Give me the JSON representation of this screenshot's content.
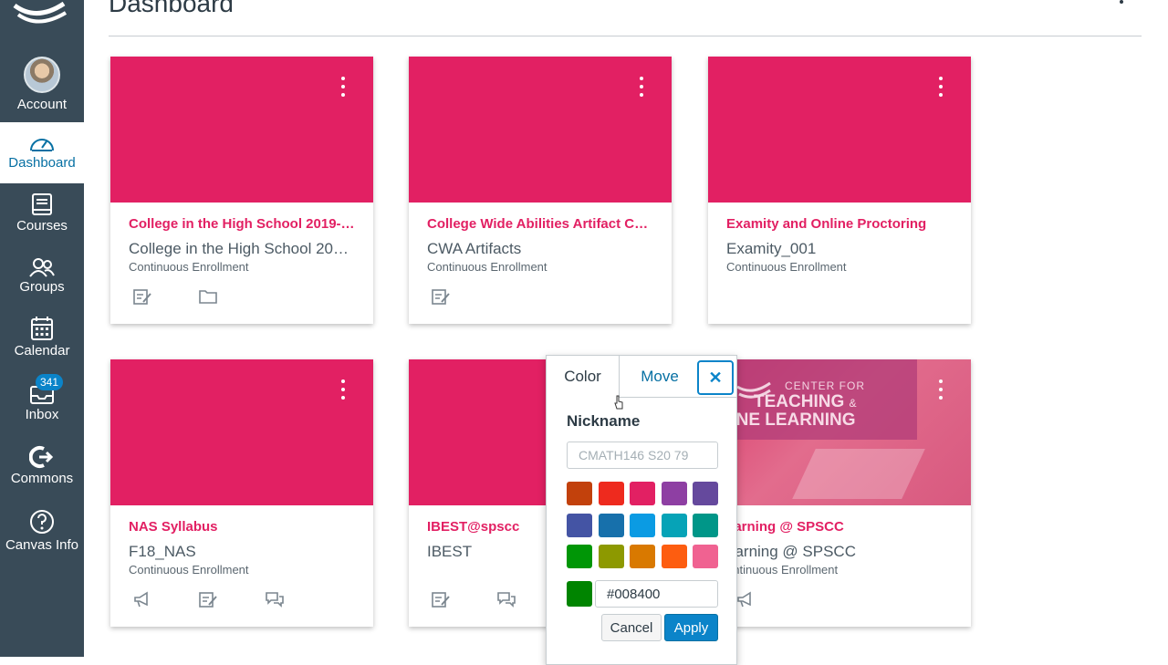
{
  "header": {
    "title": "Dashboard"
  },
  "nav": {
    "account": "Account",
    "dashboard": "Dashboard",
    "courses": "Courses",
    "groups": "Groups",
    "calendar": "Calendar",
    "inbox": "Inbox",
    "inbox_badge": "341",
    "commons": "Commons",
    "canvas_info": "Canvas Info"
  },
  "cards": [
    {
      "title": "College in the High School 2019-2…",
      "code": "College in the High School 201…",
      "term": "Continuous Enrollment",
      "color": "#e22063"
    },
    {
      "title": "College Wide Abilities Artifact Col…",
      "code": "CWA Artifacts",
      "term": "Continuous Enrollment",
      "color": "#e22063"
    },
    {
      "title": "Examity and Online Proctoring",
      "code": "Examity_001",
      "term": "Continuous Enrollment",
      "color": "#e22063"
    },
    {
      "title": "NAS Syllabus",
      "code": "F18_NAS",
      "term": "Continuous Enrollment",
      "color": "#e22063"
    },
    {
      "title": "IBEST@spscc",
      "code": "IBEST",
      "term": "",
      "color": "#e22063"
    },
    {
      "title": "earning @ SPSCC",
      "code": "earning @ SPSCC",
      "term": "ontinuous Enrollment",
      "color": "#e22063",
      "image_text": {
        "line1": "CENTER FOR",
        "line2": "TEACHING",
        "amp": "&",
        "line3": "NLINE LEARNING"
      }
    }
  ],
  "popover": {
    "tab_color": "Color",
    "tab_move": "Move",
    "close": "✕",
    "nickname_label": "Nickname",
    "nickname_placeholder": "CMATH146 S20 79",
    "swatches": [
      "#c2410c",
      "#ee2a1e",
      "#e22063",
      "#8e3fa3",
      "#65499d",
      "#4454a4",
      "#1770ab",
      "#0b9be3",
      "#06a3b7",
      "#009688",
      "#009606",
      "#8d9900",
      "#d97900",
      "#fd5d10",
      "#f06291"
    ],
    "hex_value": "#008400",
    "cancel_label": "Cancel",
    "apply_label": "Apply"
  }
}
